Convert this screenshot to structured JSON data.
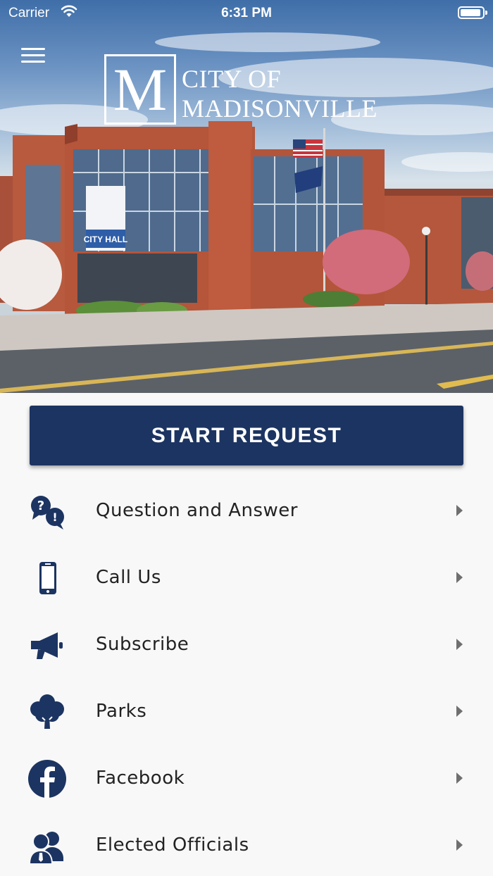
{
  "status_bar": {
    "carrier": "Carrier",
    "time": "6:31 PM"
  },
  "header": {
    "logo_letter": "M",
    "logo_line1": "CITY OF",
    "logo_line2": "MADISONVILLE",
    "hero_image": "city-hall-photo",
    "building_sign": "CITY HALL"
  },
  "primary_action": {
    "label": "START REQUEST",
    "color": "#1c3461"
  },
  "menu": {
    "items": [
      {
        "label": "Question and Answer",
        "icon": "question-answer-icon"
      },
      {
        "label": "Call Us",
        "icon": "phone-icon"
      },
      {
        "label": "Subscribe",
        "icon": "megaphone-icon"
      },
      {
        "label": "Parks",
        "icon": "tree-icon"
      },
      {
        "label": "Facebook",
        "icon": "facebook-icon"
      },
      {
        "label": "Elected Officials",
        "icon": "officials-icon"
      }
    ]
  },
  "colors": {
    "brand_navy": "#1c3461",
    "background": "#f8f8f8",
    "chevron": "#6f6f6f"
  }
}
